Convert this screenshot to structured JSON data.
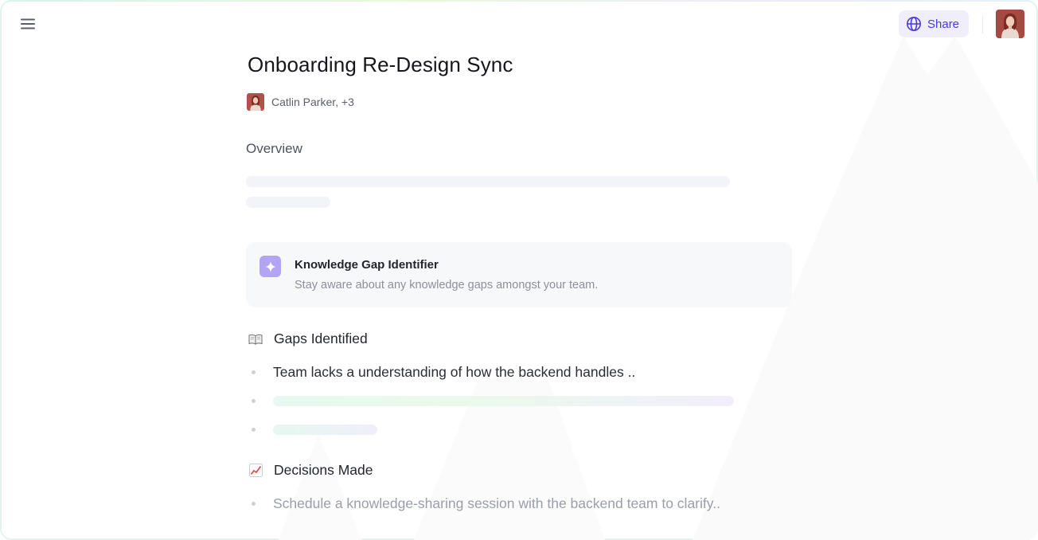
{
  "header": {
    "share_label": "Share"
  },
  "document": {
    "title": "Onboarding Re-Design Sync",
    "author": "Catlin Parker, +3",
    "overview_heading": "Overview"
  },
  "kg_card": {
    "title": "Knowledge Gap Identifier",
    "subtitle": "Stay aware about any knowledge gaps amongst your team."
  },
  "gaps": {
    "heading": "Gaps Identified",
    "items": [
      "Team lacks a understanding of how the backend handles .."
    ]
  },
  "decisions": {
    "heading": "Decisions Made",
    "items": [
      "Schedule a knowledge-sharing session with the backend team to clarify.."
    ]
  },
  "icons": {
    "menu": "hamburger-menu-icon",
    "share": "globe-icon",
    "kg": "sparkle-icon",
    "gaps": "open-book-icon",
    "decisions": "chart-increasing-icon"
  },
  "colors": {
    "accent": "#4a3bd4",
    "share_bg": "#f1eefb",
    "sparkle_bg": "#b3a5f4"
  }
}
